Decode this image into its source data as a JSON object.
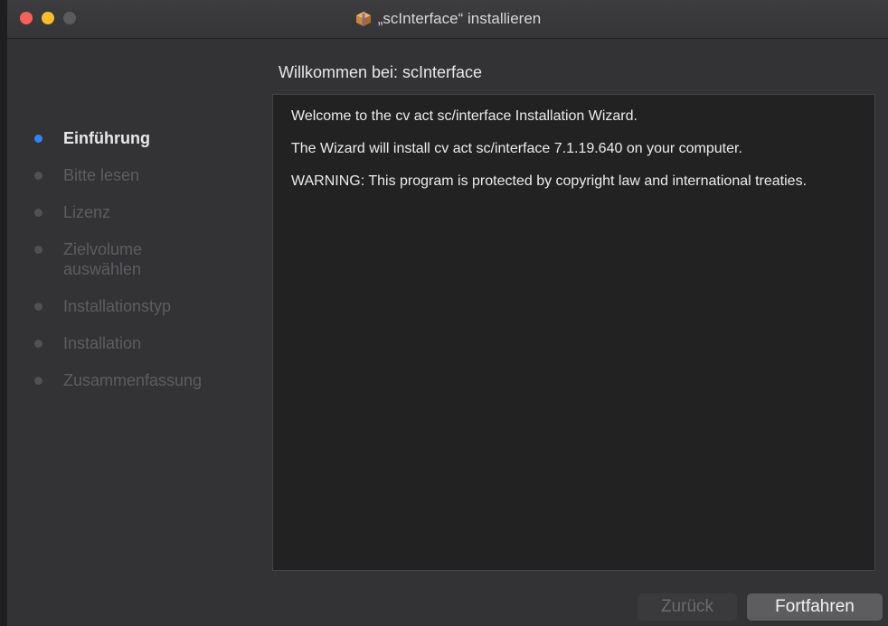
{
  "window": {
    "title": "„scInterface“ installieren"
  },
  "sidebar": {
    "items": [
      {
        "label": "Einführung"
      },
      {
        "label": "Bitte lesen"
      },
      {
        "label": "Lizenz"
      },
      {
        "label": "Zielvolume auswählen"
      },
      {
        "label": "Installationstyp"
      },
      {
        "label": "Installation"
      },
      {
        "label": "Zusammenfassung"
      }
    ]
  },
  "main": {
    "heading": "Willkommen bei: scInterface",
    "paragraphs": [
      "Welcome to the cv act sc/interface Installation Wizard.",
      "The Wizard will install cv act sc/interface 7.1.19.640 on your computer.",
      "WARNING: This program is protected by copyright law and international treaties."
    ]
  },
  "buttons": {
    "back_label": "Zurück",
    "continue_label": "Fortfahren"
  },
  "colors": {
    "active_step_dot": "#2d85f5",
    "close": "#fc5f57",
    "minimize": "#fdbc2e"
  },
  "icons": {
    "title_icon": "package-icon"
  }
}
